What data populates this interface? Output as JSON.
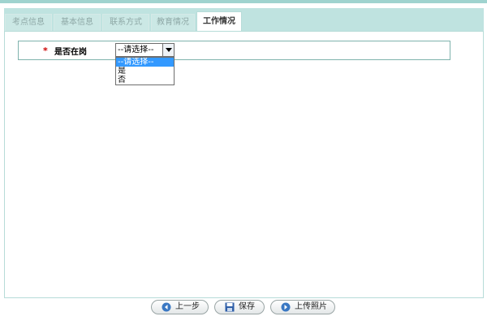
{
  "tabs": [
    {
      "label": "考点信息",
      "active": false
    },
    {
      "label": "基本信息",
      "active": false
    },
    {
      "label": "联系方式",
      "active": false
    },
    {
      "label": "教育情况",
      "active": false
    },
    {
      "label": "工作情况",
      "active": true
    }
  ],
  "form": {
    "required_mark": "*",
    "field_label": "是否在岗",
    "select_value": "--请选择--",
    "options": [
      "--请选择--",
      "是",
      "否"
    ],
    "highlighted_option": "--请选择--"
  },
  "buttons": {
    "prev": "上一步",
    "save": "保存",
    "upload_photo": "上传照片"
  },
  "icons": {
    "prev": "left-arrow-icon",
    "save": "floppy-disk-icon",
    "upload": "right-arrow-icon",
    "dropdown": "chevron-down-icon"
  },
  "colors": {
    "tab_bar": "#bfe3e0",
    "border": "#b7dcd8",
    "required": "#cc0000",
    "highlight": "#3399ff"
  }
}
